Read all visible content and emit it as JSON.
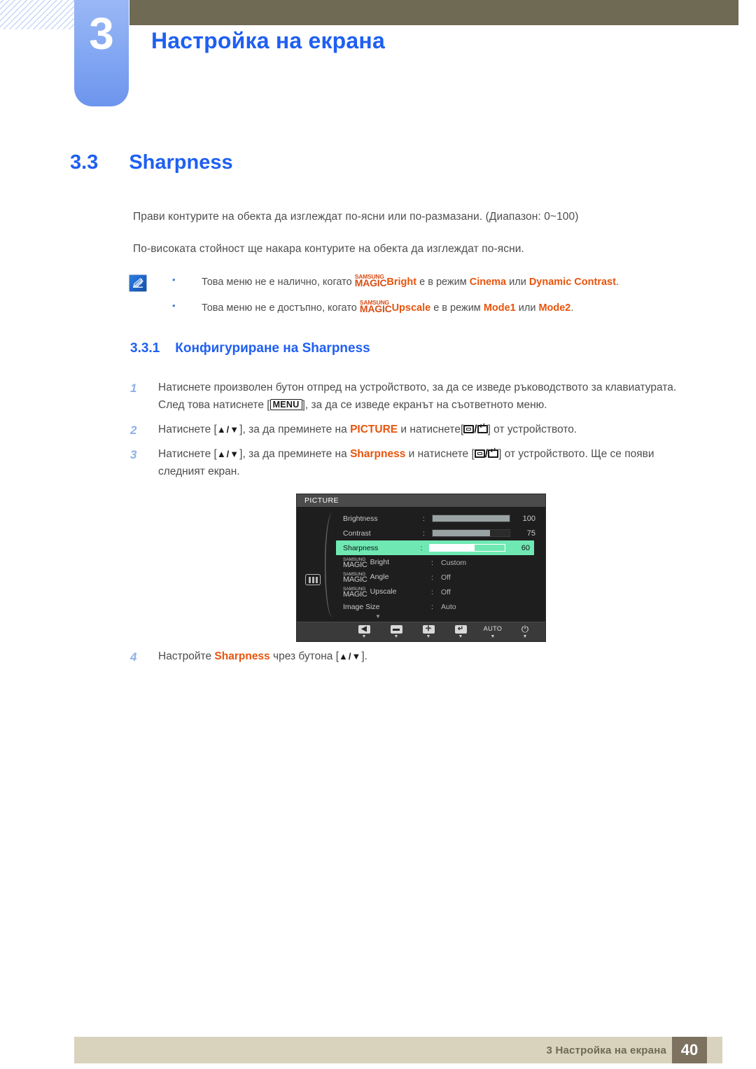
{
  "header": {
    "chapter_number": "3",
    "chapter_title": "Настройка на екрана"
  },
  "section": {
    "number": "3.3",
    "title": "Sharpness"
  },
  "paragraphs": {
    "p1": "Прави контурите на обекта да изглеждат по-ясни или по-размазани. (Диапазон: 0~100)",
    "p2": "По-високата стойност ще накара контурите на обекта да изглеждат по-ясни."
  },
  "note": {
    "icon": "note-pen-icon",
    "items": [
      {
        "before": "Това меню не е налично, когато ",
        "magic_top": "SAMSUNG",
        "magic_bottom": "MAGIC",
        "magic_suffix": "Bright",
        "middle": " е в режим ",
        "mode1": "Cinema",
        "conj": " или ",
        "mode2": "Dynamic Contrast",
        "after": "."
      },
      {
        "before": "Това меню не е достъпно, когато ",
        "magic_top": "SAMSUNG",
        "magic_bottom": "MAGIC",
        "magic_suffix": "Upscale",
        "middle": " е в режим ",
        "mode1": "Mode1",
        "conj": " или ",
        "mode2": "Mode2",
        "after": "."
      }
    ]
  },
  "subsection": {
    "number": "3.3.1",
    "title": "Конфигуриране на Sharpness"
  },
  "steps": [
    {
      "num": "1",
      "t1": "Натиснете произволен бутон отпред на устройството, за да се изведе ръководството за клавиатурата. След това натиснете [",
      "key": "MENU",
      "t2": "], за да се изведе екранът на съответното меню."
    },
    {
      "num": "2",
      "t1": "Натиснете [",
      "arrows": "▲/▼",
      "t2": "], за да преминете на ",
      "highlight": "PICTURE",
      "t3": " и натиснете[",
      "t4": "] от устройството."
    },
    {
      "num": "3",
      "t1": "Натиснете [",
      "arrows": "▲/▼",
      "t2": "], за да преминете на ",
      "highlight": "Sharpness",
      "t3": " и натиснете [",
      "t4": "] от устройството. Ще се появи следният екран."
    },
    {
      "num": "4",
      "t1": "Настройте ",
      "highlight": "Sharpness",
      "t2": " чрез бутона [",
      "arrows": "▲/▼",
      "t3": "]."
    }
  ],
  "osd": {
    "title": "PICTURE",
    "category_icon": "picture-bars-icon",
    "scroll_down_icon": "▼",
    "rows": [
      {
        "label": "Brightness",
        "type": "bar",
        "value": "100",
        "fill_pct": 100
      },
      {
        "label": "Contrast",
        "type": "bar",
        "value": "75",
        "fill_pct": 75
      },
      {
        "label": "Sharpness",
        "type": "bar",
        "value": "60",
        "fill_pct": 60,
        "selected": true
      },
      {
        "label": "Bright",
        "type": "value",
        "value": "Custom",
        "magic_top": "SAMSUNG",
        "magic_bottom": "MAGIC"
      },
      {
        "label": "Angle",
        "type": "value",
        "value": "Off",
        "magic_top": "SAMSUNG",
        "magic_bottom": "MAGIC"
      },
      {
        "label": "Upscale",
        "type": "value",
        "value": "Off",
        "magic_top": "SAMSUNG",
        "magic_bottom": "MAGIC"
      },
      {
        "label": "Image Size",
        "type": "value",
        "value": "Auto"
      }
    ],
    "buttons": [
      {
        "name": "back-button",
        "glyph": "◀"
      },
      {
        "name": "minus-button",
        "glyph": "▬"
      },
      {
        "name": "plus-button",
        "glyph": "✛"
      },
      {
        "name": "enter-button",
        "glyph": "↵"
      },
      {
        "name": "auto-button",
        "glyph": "AUTO"
      },
      {
        "name": "power-button",
        "glyph": "⏻"
      }
    ]
  },
  "footer": {
    "text": "3 Настройка на екрана",
    "page": "40"
  },
  "colors": {
    "accent_blue": "#1f5ff2",
    "orange": "#e8540c",
    "magic_orange": "#d94f16",
    "olive": "#6e6a53",
    "footer_beige": "#d9d2bd",
    "osd_green": "#6fe8b4"
  }
}
